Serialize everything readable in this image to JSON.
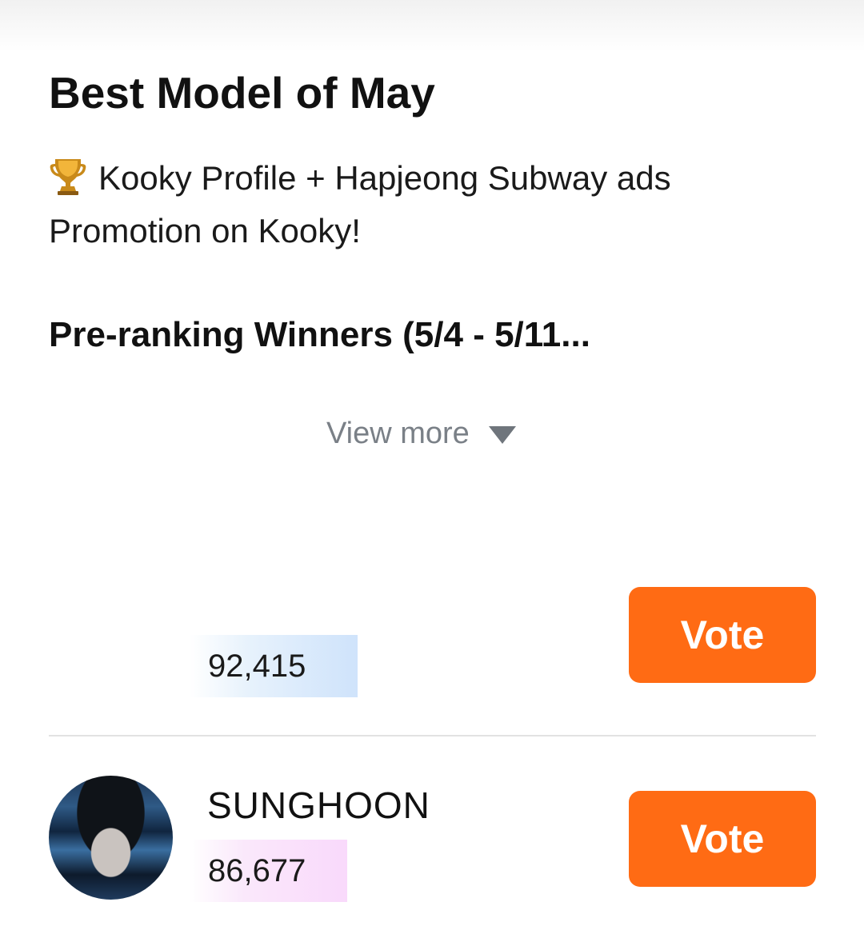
{
  "event": {
    "title": "Best Model of May",
    "description_line1": "Kooky Profile + Hapjeong Subway ads",
    "description_line2": "Promotion on Kooky!",
    "trophy_icon": "trophy-icon",
    "subheading": "Pre-ranking Winners (5/4 - 5/11...",
    "view_more_label": "View more",
    "view_more_icon": "caret-down-icon"
  },
  "colors": {
    "accent": "#ff6b14",
    "vote_bar_blue": "#cfe3fb",
    "vote_bar_pink": "#f9d9fb",
    "muted_text": "#7a8087"
  },
  "candidates": [
    {
      "name": "",
      "votes": "92,415",
      "vote_label": "Vote"
    },
    {
      "name": "SUNGHOON",
      "votes": "86,677",
      "vote_label": "Vote"
    }
  ]
}
